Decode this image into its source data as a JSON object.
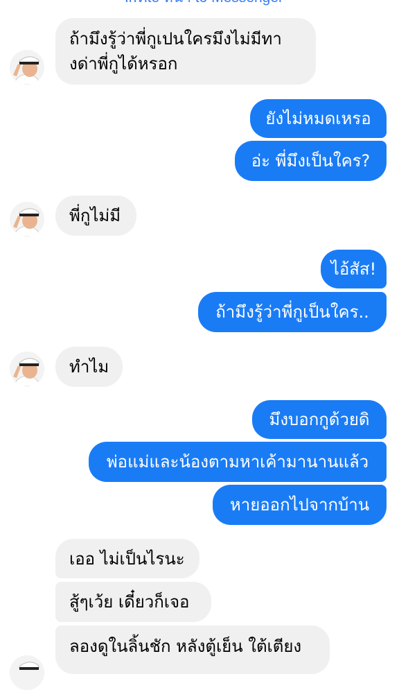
{
  "header": {
    "invite_text": "Invite หน้า to Messenger"
  },
  "messages": [
    {
      "from": "them",
      "text_line1": "ถ้ามึงรู้ว่าพี่กูเปนใครมึงไม่มีทา",
      "text_line2": "งด่าพี่กูได้หรอก"
    },
    {
      "from": "me",
      "text": "ยังไม่หมดเหรอ"
    },
    {
      "from": "me",
      "text": "อ่ะ พี่มึงเป็นใคร?"
    },
    {
      "from": "them",
      "text": "พี่กูไม่มี"
    },
    {
      "from": "me",
      "text": "ไอ้สัส!"
    },
    {
      "from": "me",
      "text": "ถ้ามึงรู้ว่าพี่กูเป็นใคร.."
    },
    {
      "from": "them",
      "text": "ทำไม"
    },
    {
      "from": "me",
      "text": "มึงบอกกูด้วยดิ"
    },
    {
      "from": "me",
      "text": "พ่อแม่และน้องตามหาเค้ามานานแล้ว"
    },
    {
      "from": "me",
      "text": "หายออกไปจากบ้าน"
    },
    {
      "from": "them",
      "text": "เออ ไม่เป็นไรนะ"
    },
    {
      "from": "them",
      "text": "สู้ๆเว้ย เดี๋ยวก็เจอ"
    },
    {
      "from": "them",
      "text": "ลองดูในลิ้นชัก หลังตู้เย็น ใต้เตียง"
    }
  ],
  "contact": {
    "avatar_icon": "captain-hat-man-avatar"
  },
  "colors": {
    "outgoing_bubble": "#1a7cf5",
    "incoming_bubble": "#f1f0f0",
    "link": "#3b7cf2"
  }
}
